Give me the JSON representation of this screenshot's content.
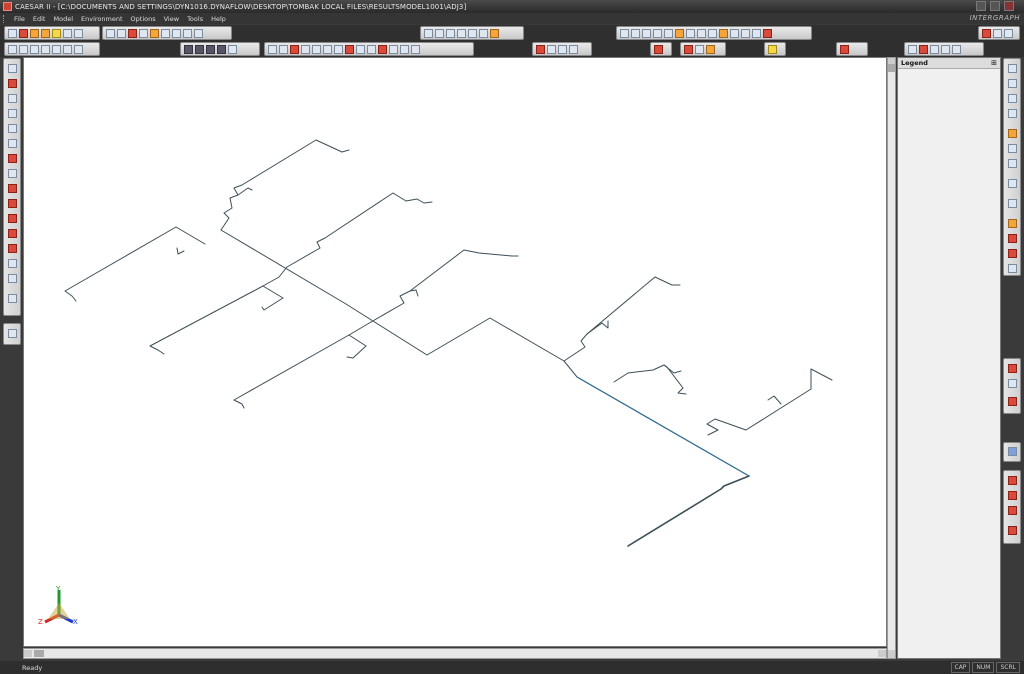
{
  "window": {
    "title": "CAESAR II - [C:\\DOCUMENTS AND SETTINGS\\DYN1016.DYNAFLOW\\DESKTOP\\TOMBAK LOCAL FILES\\RESULTSMODEL1001\\ADJ3]",
    "brand": "INTERGRAPH"
  },
  "menu": {
    "items": [
      "File",
      "Edit",
      "Model",
      "Environment",
      "Options",
      "View",
      "Tools",
      "Help"
    ]
  },
  "legend": {
    "title": "Legend",
    "pin_glyph": "⊞"
  },
  "axis_triad": {
    "x_label": "X",
    "y_label": "Y",
    "z_label": "Z",
    "colors": {
      "x": "#1a3cc8",
      "y": "#1e9a2a",
      "z": "#d22a1e"
    }
  },
  "model_colors": {
    "pipe": "#3c4f58",
    "highlight_pipe": "#2e6f94"
  },
  "statusbar": {
    "text": "Ready",
    "indicators": [
      "CAP",
      "NUM",
      "SCRL"
    ]
  }
}
